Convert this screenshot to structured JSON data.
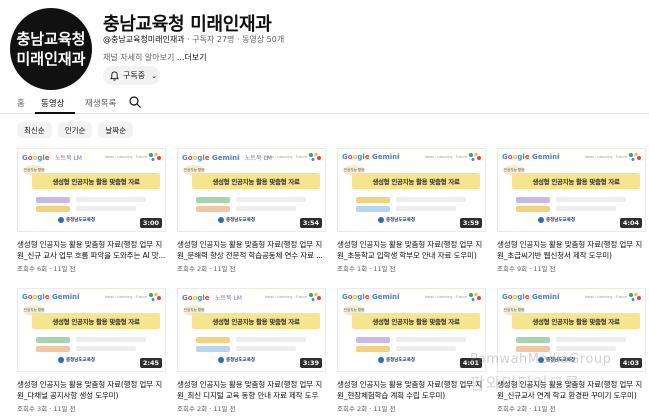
{
  "channel": {
    "avatar_line1": "충남교육청",
    "avatar_line2": "미래인재과",
    "title": "충남교육청 미래인재과",
    "handle": "@충남교육청미래인재과",
    "subscribers": "구독자 27명",
    "videos": "동영상 50개",
    "description": "채널 자세히 알아보기",
    "more": "...더보기",
    "subscribe_label": "구독중"
  },
  "tabs": [
    {
      "label": "홈"
    },
    {
      "label": "동영상"
    },
    {
      "label": "재생목록"
    }
  ],
  "active_tab": "동영상",
  "chips": [
    "최신순",
    "인기순",
    "날짜순"
  ],
  "thumb": {
    "banner_text": "생성형 인공지능 활용 맞춤형 자료",
    "bubble": "인공지능 활용",
    "org": "충청남도교육청",
    "tiny_caption": "Ideas · Learning · Future"
  },
  "videos": [
    {
      "title": "생성형 인공지능 활용 맞춤형 자료(행정 업무 지원_신규 교사 업무 흐름 파악을 도와주는 AI 맛...",
      "meta": "조회수 6회 · 11일 전",
      "duration": "3:00",
      "logo_side": "노트북 LM",
      "logo": "Google"
    },
    {
      "title": "생성형 인공지능 활용 맞춤형 자료(행정 업무 지원_문해력 향상 전문적 학습공동체 연수 자료 ...",
      "meta": "조회수 2회 · 11일 전",
      "duration": "3:54",
      "logo_side": "노트북 LM",
      "logo": "Google Gemini"
    },
    {
      "title": "생성형 인공지능 활용 맞춤형 자료(행정 업무 지원_초등학교 입학생 학부모 안내 자료 도우미)",
      "meta": "조회수 1회 · 11일 전",
      "duration": "3:59",
      "logo_side": "",
      "logo": "Google Gemini"
    },
    {
      "title": "생성형 인공지능 활용 맞춤형 자료(행정 업무 지원_초급씨기반 웹신청서 제작 도우미)",
      "meta": "조회수 9회 · 11일 전",
      "duration": "4:04",
      "logo_side": "",
      "logo": "Google Gemini"
    },
    {
      "title": "생성형 인공지능 활용 맞춤형 자료(행정 업무 지원_다채널 공지사항 생성 도우미)",
      "meta": "조회수 3회 · 11일 전",
      "duration": "2:45",
      "logo_side": "",
      "logo": "Google Gemini"
    },
    {
      "title": "생성형 인공지능 활용 맞춤형 자료(행정 업무 지원_최신 디지털 교육 동향 안내 자료 제작 도우미)",
      "meta": "조회수 2회 · 11일 전",
      "duration": "3:39",
      "logo_side": "노트북 LM",
      "logo": "Google"
    },
    {
      "title": "생성형 인공지능 활용 맞춤형 자료(행정 업무 지원_현장체험학습 계획 수립 도우미)",
      "meta": "조회수 2회 · 11일 전",
      "duration": "4:01",
      "logo_side": "",
      "logo": "Google Gemini"
    },
    {
      "title": "생성형 인공지능 활용 맞춤형 자료(행정 업무 지원_신규교사 연계 학교 환경판 꾸미기 도우미)",
      "meta": "조회수 2회 · 11일 전",
      "duration": "4:03",
      "logo_side": "",
      "logo": "Google Gemini"
    }
  ],
  "watermark": {
    "line1": "PamwahMediaGroup",
    "line2": "팜와미디어그룹"
  },
  "colors": {
    "banner": "#f6e58d",
    "chip_bg": "#f2f2f2",
    "text_secondary": "#606060"
  }
}
